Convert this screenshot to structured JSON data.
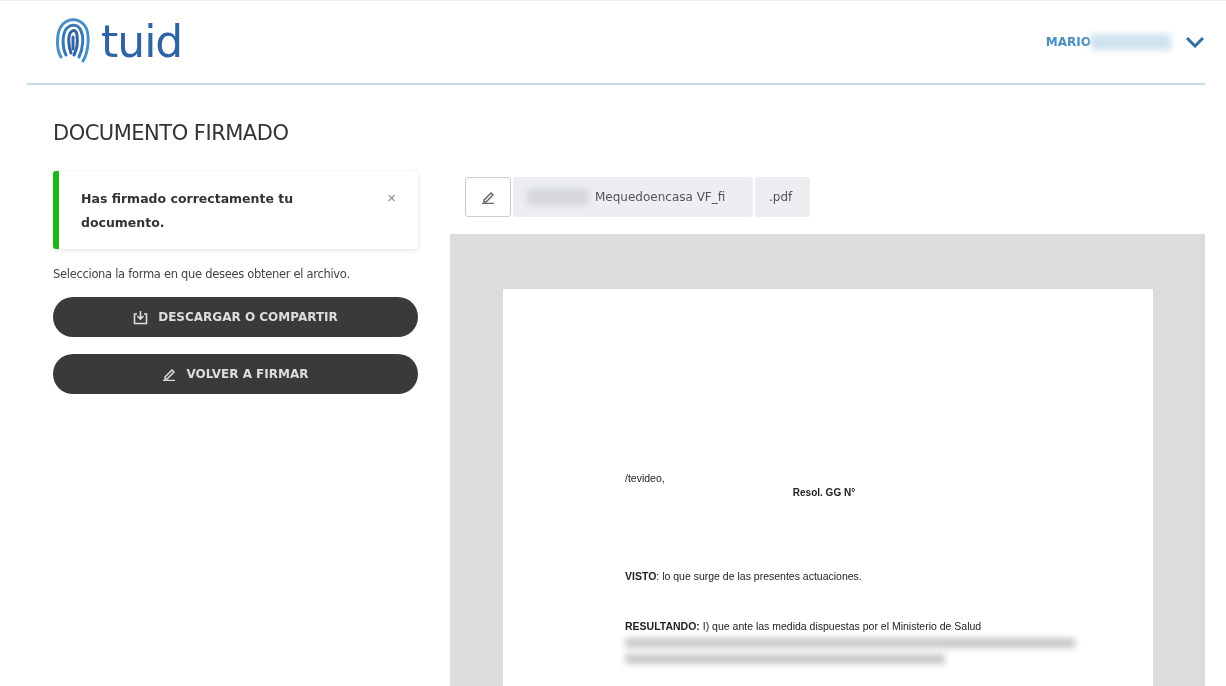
{
  "header": {
    "logo_text": "tuid",
    "user_name": "MARIO"
  },
  "page_title": "DOCUMENTO FIRMADO",
  "alert": {
    "message": "Has firmado correctamente tu documento.",
    "color": "#1db31d",
    "close_glyph": "×"
  },
  "instruction": "Selecciona la forma en que desees obtener el archivo.",
  "buttons": [
    {
      "kind": "download",
      "label": "DESCARGAR O COMPARTIR"
    },
    {
      "kind": "sign",
      "label": "VOLVER A FIRMAR"
    }
  ],
  "file": {
    "name": "Mequedoencasa VF_fi",
    "extension": ".pdf"
  },
  "document": {
    "place": "/tevideo,",
    "resolution": "Resol.  GG N°",
    "paragraphs": [
      "**VISTO**: lo que surge de las presentes actuaciones.",
      "**RESULTANDO:** I) que ante las medida dispuestas por el Ministerio de Salud"
    ]
  }
}
